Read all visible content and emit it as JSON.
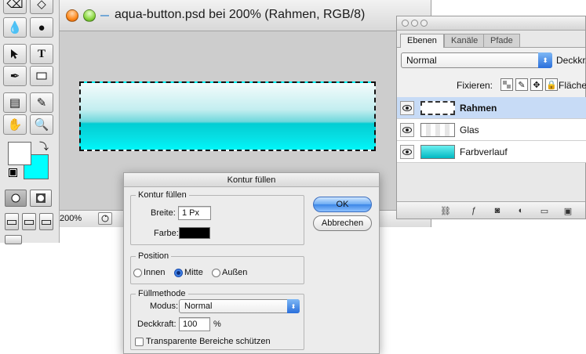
{
  "document": {
    "title": "aqua-button.psd bei 200% (Rahmen, RGB/8)",
    "zoom": "200%"
  },
  "tools": {
    "foreground_color": "#ffffff",
    "background_color": "#00ffff"
  },
  "layers_panel": {
    "tabs": [
      "Ebenen",
      "Kanäle",
      "Pfade"
    ],
    "blend_mode": "Normal",
    "opacity_label": "Deckkr.",
    "lock_label": "Fixieren:",
    "fill_label": "Fläche",
    "layers": [
      {
        "name": "Rahmen",
        "selected": true
      },
      {
        "name": "Glas",
        "selected": false
      },
      {
        "name": "Farbverlauf",
        "selected": false
      }
    ]
  },
  "dialog": {
    "title": "Kontur füllen",
    "contour_group": "Kontur füllen",
    "width_label": "Breite:",
    "width_value": "1 Px",
    "color_label": "Farbe:",
    "stroke_color": "#000000",
    "position_group": "Position",
    "position_options": [
      "Innen",
      "Mitte",
      "Außen"
    ],
    "position_selected": "Mitte",
    "fill_group": "Füllmethode",
    "mode_label": "Modus:",
    "mode_value": "Normal",
    "opacity_label": "Deckkraft:",
    "opacity_value": "100",
    "percent": "%",
    "preserve_label": "Transparente Bereiche schützen",
    "ok": "OK",
    "cancel": "Abbrechen"
  }
}
